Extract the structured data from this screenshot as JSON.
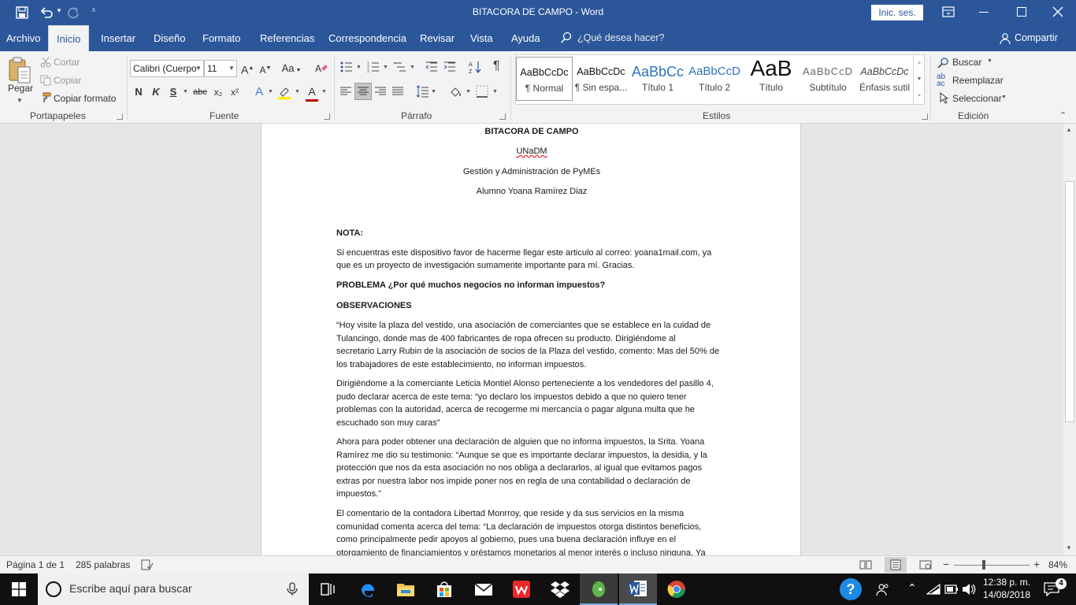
{
  "window": {
    "title": "BITACORA DE CAMPO  -  Word",
    "signin_label": "Inic. ses."
  },
  "tabs": [
    "Archivo",
    "Inicio",
    "Insertar",
    "Diseño",
    "Formato",
    "Referencias",
    "Correspondencia",
    "Revisar",
    "Vista",
    "Ayuda"
  ],
  "tell_me": "¿Qué desea hacer?",
  "share_label": "Compartir",
  "clipboard": {
    "paste": "Pegar",
    "cut": "Cortar",
    "copy": "Copiar",
    "format_painter": "Copiar formato",
    "group": "Portapapeles"
  },
  "font": {
    "name": "Calibri (Cuerpo",
    "size": "11",
    "group": "Fuente",
    "bold": "N",
    "italic": "K",
    "underline": "S",
    "strike": "abc",
    "sub": "x₂",
    "sup": "x²",
    "change_case": "Aa",
    "grow": "A",
    "shrink": "A",
    "font_color": "A",
    "text_effects": "A"
  },
  "paragraph": {
    "group": "Párrafo"
  },
  "styles": {
    "group": "Estilos",
    "items": [
      {
        "sample": "AaBbCcDc",
        "name": "¶ Normal"
      },
      {
        "sample": "AaBbCcDc",
        "name": "¶ Sin espa..."
      },
      {
        "sample": "AaBbCc",
        "name": "Título 1"
      },
      {
        "sample": "AaBbCcD",
        "name": "Título 2"
      },
      {
        "sample": "AaB",
        "name": "Título"
      },
      {
        "sample": "AaBbCcD",
        "name": "Subtítulo"
      },
      {
        "sample": "AaBbCcDc",
        "name": "Énfasis sutil"
      }
    ]
  },
  "editing": {
    "find": "Buscar",
    "replace": "Reemplazar",
    "select": "Seleccionar",
    "group": "Edición"
  },
  "document": {
    "header_lines": [
      "BITACORA DE CAMPO",
      "UNaDM",
      "Gestión y Administración de PyMEs",
      "Alumno Yoana Ramírez Diaz"
    ],
    "nota": "NOTA:",
    "nota_p": [
      "Si encuentras este dispositivo favor de hacerme llegar este articulo al correo: yoana1mail.com, ya",
      "que es un proyecto de investigación sumamente importante para mí. Gracias."
    ],
    "problema": "PROBLEMA ¿Por qué muchos negocios no informan impuestos?",
    "observaciones": "OBSERVACIONES",
    "p1": [
      "“Hoy visite la plaza del vestido, una asociación de comerciantes que se establece en la cuidad de",
      "Tulancingo, donde mas de 400 fabricantes de ropa ofrecen su producto. Dirigiéndome al",
      "secretario Larry Rubin de la asociación de socios de la Plaza del vestido, comento: Mas del 50% de",
      "los trabajadores de este establecimiento, no informan impuestos."
    ],
    "p2": [
      "Dirigiéndome a la comerciante Leticia Montiel Alonso perteneciente a los vendedores del pasillo 4,",
      "pudo declarar acerca de este tema: “yo declaro los impuestos debido a que no quiero tener",
      "problemas con la autoridad, acerca de recogerme mi mercancía o pagar alguna multa que he",
      "escuchado son muy caras”"
    ],
    "p3": [
      "Ahora para poder obtener una declaración de alguien que no informa impuestos, la Srita. Yoana",
      "Ramírez me dio su testimonio: “Aunque se que es importante declarar impuestos, la desidia, y la",
      "protección que nos da esta asociación no nos obliga a declararlos, al igual que evitamos pagos",
      "extras por nuestra labor nos impide poner nos en regla de una contabilidad o declaración de",
      "impuestos.”"
    ],
    "p4": [
      "El comentario de la contadora Libertad Monrroy, que reside y da sus servicios en la misma",
      "comunidad comenta acerca del tema: “La declaración de impuestos otorga distintos beneficios,",
      "como principalmente pedir apoyos al gobierno, pues una buena declaración influye en el",
      "otorgamiento de financiamientos y préstamos monetarios al menor interés o incluso ninguna. Ya"
    ]
  },
  "status": {
    "page": "Página 1 de 1",
    "words": "285 palabras",
    "zoom": "84%"
  },
  "taskbar": {
    "search_placeholder": "Escribe aquí para buscar",
    "time": "12:38 p. m.",
    "date": "14/08/2018"
  },
  "colors": {
    "word_blue": "#2b579a",
    "ribbon_bg": "#f3f3f3",
    "taskbar_bg": "#101010"
  }
}
